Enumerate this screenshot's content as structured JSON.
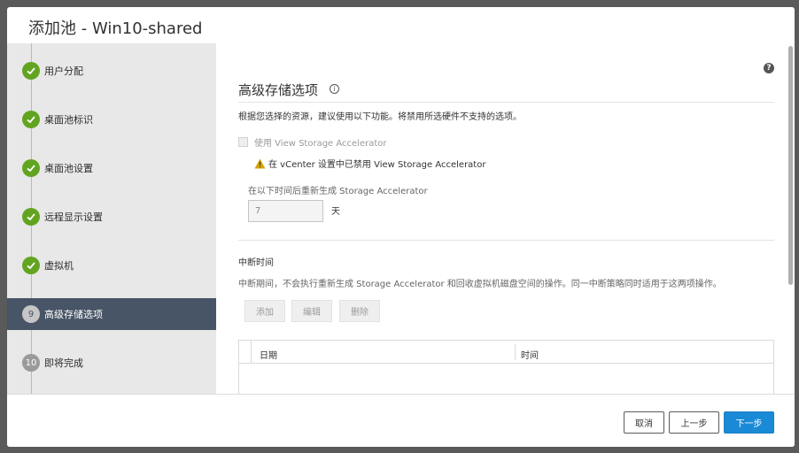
{
  "dialog": {
    "title": "添加池 - Win10-shared"
  },
  "steps": [
    {
      "label": "用户分配",
      "state": "done"
    },
    {
      "label": "桌面池标识",
      "state": "done"
    },
    {
      "label": "桌面池设置",
      "state": "done"
    },
    {
      "label": "远程显示设置",
      "state": "done"
    },
    {
      "label": "虚拟机",
      "state": "done"
    },
    {
      "number": "9",
      "label": "高级存储选项",
      "state": "active"
    },
    {
      "number": "10",
      "label": "即将完成",
      "state": "todo"
    }
  ],
  "main": {
    "help_glyph": "?",
    "info_glyph": "i",
    "title": "高级存储选项",
    "description": "根据您选择的资源，建议使用以下功能。将禁用所选硬件不支持的选项。",
    "vsa_checkbox_label": "使用 View Storage Accelerator",
    "vsa_checked": false,
    "warning_text": "在 vCenter 设置中已禁用 View Storage Accelerator",
    "regen_label": "在以下时间后重新生成 Storage Accelerator",
    "regen_days_value": "7",
    "regen_days_unit": "天",
    "blackout": {
      "title": "中断时间",
      "description": "中断期间，不会执行重新生成 Storage Accelerator 和回收虚拟机磁盘空间的操作。同一中断策略同时适用于这两项操作。",
      "add_label": "添加",
      "edit_label": "编辑",
      "delete_label": "删除",
      "columns": [
        "日期",
        "时间"
      ]
    }
  },
  "footer": {
    "cancel_label": "取消",
    "back_label": "上一步",
    "next_label": "下一步"
  },
  "colors": {
    "done": "#62a420",
    "active_step_bg": "#485566",
    "primary": "#1a8ad6",
    "warning": "#d8a300"
  }
}
